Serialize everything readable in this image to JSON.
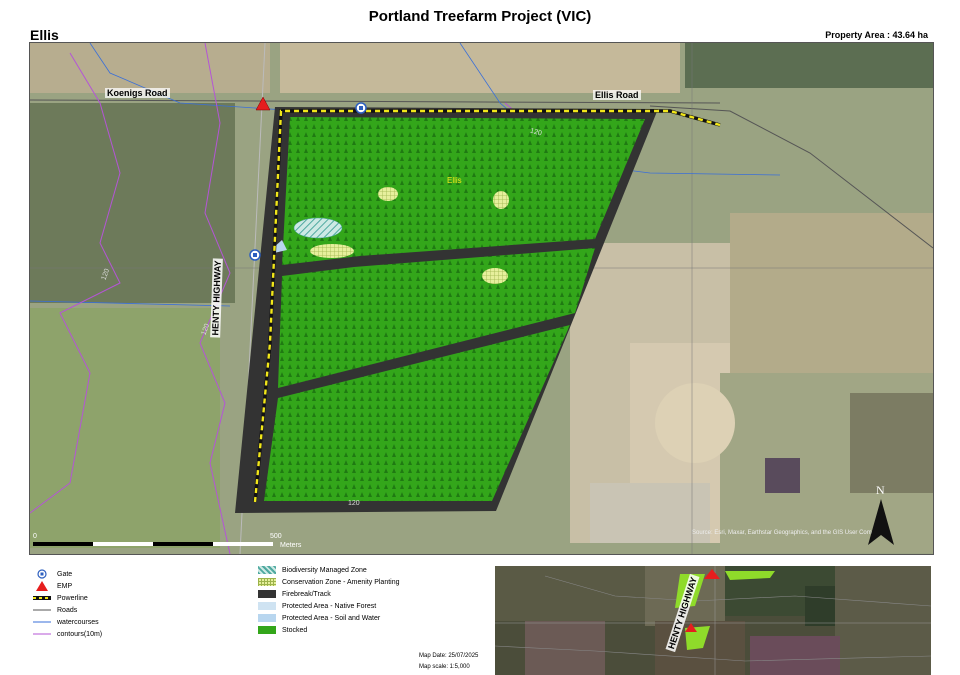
{
  "header": {
    "title": "Portland Treefarm Project (VIC)",
    "property_name": "Ellis",
    "property_area": "Property Area : 43.64 ha"
  },
  "map": {
    "road_labels": [
      "Koenigs Road",
      "Ellis Road",
      "HENTY HIGHWAY"
    ],
    "parcel_label": "Ellis",
    "contour_labels": [
      "120",
      "120",
      "120",
      "120"
    ],
    "scale": {
      "start": "0",
      "end": "500",
      "unit": "Meters"
    },
    "north_label": "N",
    "credits": "Source: Esri, Maxar, Earthstar Geographics, and the GIS User Community",
    "colors": {
      "stocked": "#33a61a",
      "firebreak": "#333333",
      "powerline": "#f2e71a",
      "contour": "#b455d6",
      "watercourse": "#3a6fd8",
      "emp": "#e61e1e"
    }
  },
  "legend": {
    "col1": [
      {
        "label": "Gate",
        "icon": "gate-icon"
      },
      {
        "label": "EMP",
        "icon": "triangle-icon"
      },
      {
        "label": "Powerline",
        "icon": "powerline-icon"
      },
      {
        "label": "Roads",
        "icon": "line-icon"
      },
      {
        "label": "watercourses",
        "icon": "line-icon"
      },
      {
        "label": "contours(10m)",
        "icon": "line-icon"
      }
    ],
    "col2": [
      {
        "label": "Biodiversity Managed Zone",
        "color": "#86c9c2"
      },
      {
        "label": "Conservation Zone - Amenity Planting",
        "color": "#d9e89a"
      },
      {
        "label": "Firebreak/Track",
        "color": "#333333"
      },
      {
        "label": "Protected Area - Native Forest",
        "color": "#cfe3f2"
      },
      {
        "label": "Protected Area - Soil and Water",
        "color": "#b8d6ef"
      },
      {
        "label": "Stocked",
        "color": "#33a61a"
      }
    ]
  },
  "map_info": {
    "date": "Map Date: 25/07/2025",
    "scale": "Map scale: 1:5,000"
  },
  "inset": {
    "road_label": "HENTY HIGHWAY"
  }
}
